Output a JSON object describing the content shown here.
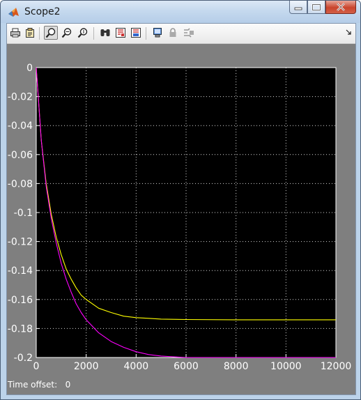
{
  "window": {
    "title": "Scope2"
  },
  "toolbar": {
    "buttons": [
      "print-icon",
      "parameters-icon",
      "zoom-icon",
      "zoom-x-icon",
      "zoom-y-icon",
      "autoscale-icon",
      "save-axes-icon",
      "restore-axes-icon",
      "floating-scope-icon",
      "lock-icon",
      "signal-selection-icon"
    ]
  },
  "status": {
    "label": "Time offset:",
    "value": "0"
  },
  "chart_data": {
    "type": "line",
    "xlim": [
      0,
      12000
    ],
    "ylim": [
      -0.2,
      0
    ],
    "x_ticks": [
      "0",
      "2000",
      "4000",
      "6000",
      "8000",
      "10000",
      "12000"
    ],
    "y_ticks": [
      "0",
      "-0.02",
      "-0.04",
      "-0.06",
      "-0.08",
      "-0.1",
      "-0.12",
      "-0.14",
      "-0.16",
      "-0.18",
      "-0.2"
    ],
    "grid": true,
    "background": "#000000",
    "series": [
      {
        "color": "#ffff00",
        "x": [
          0,
          200,
          400,
          600,
          800,
          1000,
          1200,
          1400,
          1600,
          1800,
          2000,
          2500,
          3000,
          3500,
          4000,
          4500,
          5000,
          6000,
          8000,
          10000,
          12000
        ],
        "y": [
          0,
          -0.05,
          -0.08,
          -0.101,
          -0.117,
          -0.129,
          -0.139,
          -0.146,
          -0.152,
          -0.157,
          -0.16,
          -0.166,
          -0.169,
          -0.1715,
          -0.1725,
          -0.173,
          -0.1735,
          -0.1738,
          -0.174,
          -0.174,
          -0.174
        ]
      },
      {
        "color": "#ff00ff",
        "x": [
          0,
          200,
          400,
          600,
          800,
          1000,
          1200,
          1400,
          1600,
          1800,
          2000,
          2500,
          3000,
          3500,
          4000,
          4500,
          5000,
          5500,
          6000,
          8000,
          10000,
          12000
        ],
        "y": [
          0,
          -0.05,
          -0.082,
          -0.104,
          -0.121,
          -0.135,
          -0.146,
          -0.155,
          -0.163,
          -0.169,
          -0.174,
          -0.183,
          -0.189,
          -0.193,
          -0.196,
          -0.198,
          -0.199,
          -0.1995,
          -0.2,
          -0.2,
          -0.2,
          -0.2
        ]
      }
    ]
  }
}
